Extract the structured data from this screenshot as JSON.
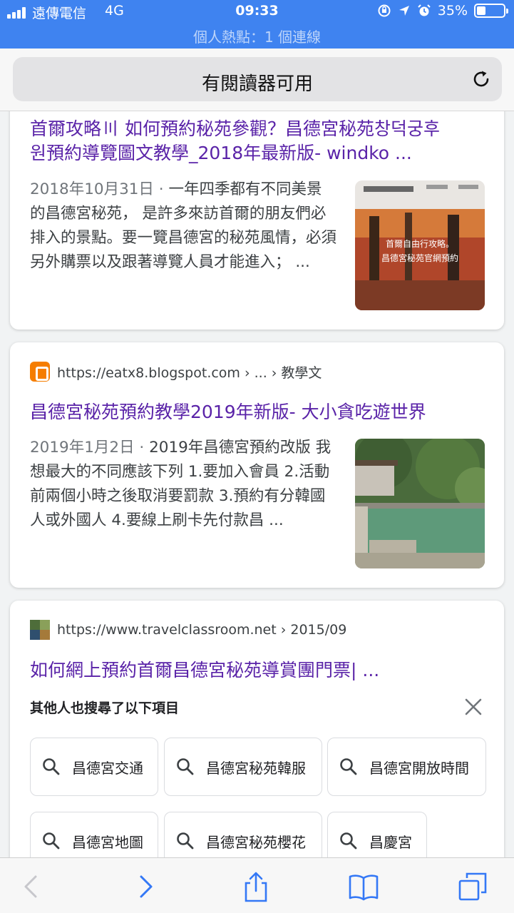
{
  "status_bar": {
    "carrier": "遠傳電信",
    "network": "4G",
    "time": "09:33",
    "battery": "35%",
    "hotspot": "個人熱點：1 個連線"
  },
  "url_bar": {
    "text": "有閱讀器可用"
  },
  "results": [
    {
      "title": "首爾攻略〣 如何預約秘苑參觀？昌德宮秘苑창덕궁후원預約導覽圖文教學_2018年最新版- windko ...",
      "title_line1": "首爾攻略〣 如何預約秘苑參觀？昌德宮秘苑창덕궁후",
      "title_line2": "원預約導覽圖文教學_2018年最新版- windko ...",
      "date": "2018年10月31日",
      "snippet": "一年四季都有不同美景的昌德宮秘苑， 是許多來訪首爾的朋友們必排入的景點。要一覽昌德宮的秘苑風情，必須另外購票以及跟著導覽人員才能進入；  ...",
      "thumb_text": "首爾自由行攻略。昌德宮秘苑官網預約"
    },
    {
      "source": "https://eatx8.blogspot.com › ... › 教學文",
      "title": "昌德宮秘苑預約教學2019年新版- 大小貪吃遊世界",
      "date": "2019年1月2日",
      "snippet": "2019年昌德宮預約改版 我想最大的不同應該下列 1.要加入會員 2.活動前兩個小時之後取消要罰款 3.預約有分韓國人或外國人 4.要線上刷卡先付款昌 ..."
    },
    {
      "source": "https://www.travelclassroom.net › 2015/09",
      "title": "如何網上預約首爾昌德宮秘苑導賞團門票| ..."
    }
  ],
  "people_also_search": {
    "heading": "其他人也搜尋了以下項目",
    "chips": [
      "昌德宮交通",
      "昌德宮秘苑韓服",
      "昌德宮開放時間",
      "昌德宮地圖",
      "昌德宮秘苑櫻花",
      "昌慶宮"
    ]
  },
  "colors": {
    "status_bar": "#3f83f0",
    "link_visited": "#5a23a8",
    "toolbar_icon": "#3478f6"
  }
}
